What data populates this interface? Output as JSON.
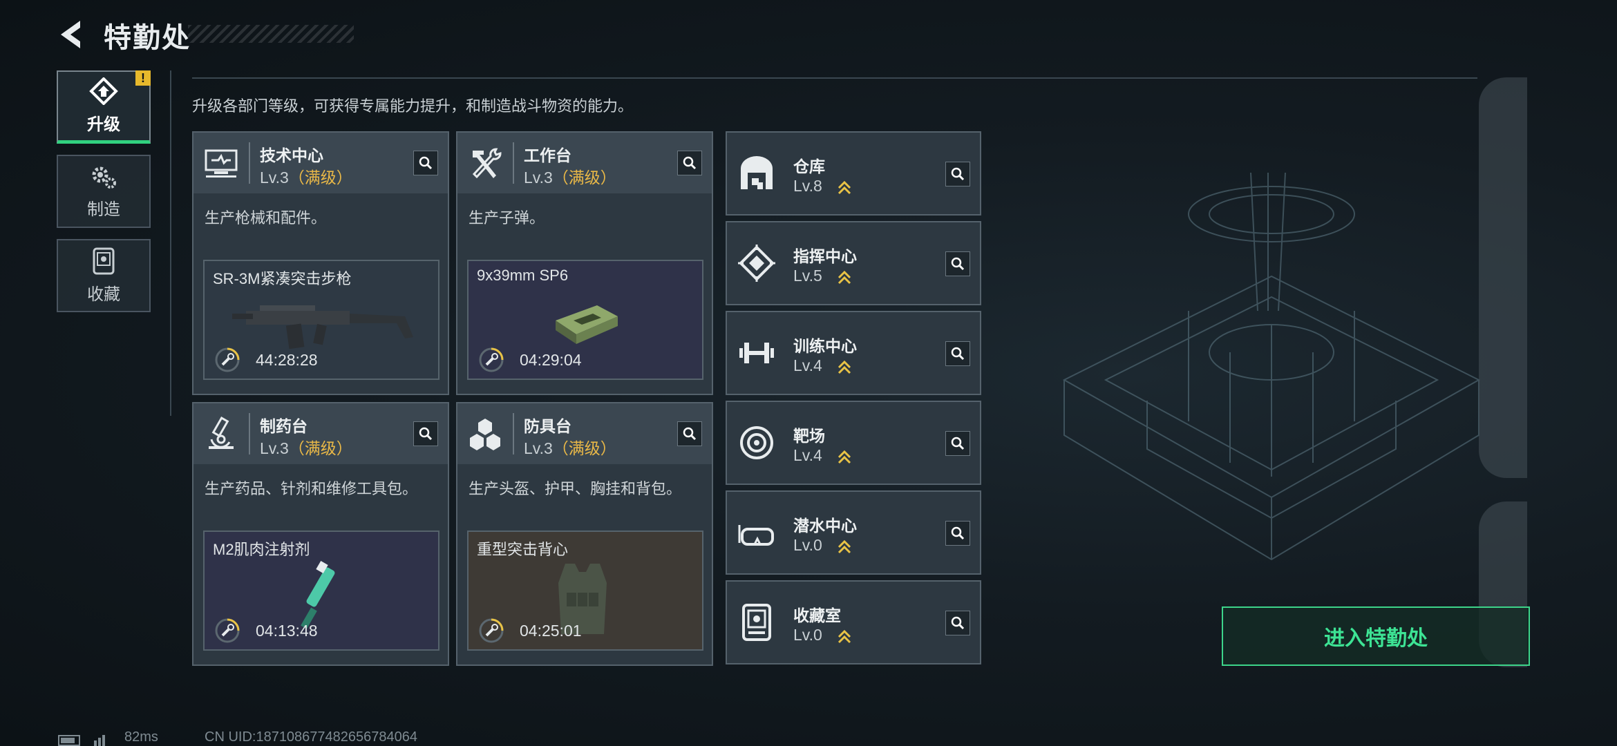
{
  "header": {
    "title": "特勤处"
  },
  "nav": [
    {
      "label": "升级",
      "icon": "upgrade-icon",
      "active": true,
      "badge": "!"
    },
    {
      "label": "制造",
      "icon": "gears-icon",
      "active": false
    },
    {
      "label": "收藏",
      "icon": "collection-icon",
      "active": false
    }
  ],
  "description": "升级各部门等级，可获得专属能力提升，和制造战斗物资的能力。",
  "max_tag": "（满级）",
  "cards": [
    {
      "name": "技术中心",
      "level": "Lv.3",
      "desc": "生产枪械和配件。",
      "product": "SR-3M紧凑突击步枪",
      "time": "44:28:28",
      "icon": "monitor-icon"
    },
    {
      "name": "工作台",
      "level": "Lv.3",
      "desc": "生产子弹。",
      "product": "9x39mm SP6",
      "time": "04:29:04",
      "icon": "tools-icon"
    },
    {
      "name": "制药台",
      "level": "Lv.3",
      "desc": "生产药品、针剂和维修工具包。",
      "product": "M2肌肉注射剂",
      "time": "04:13:48",
      "icon": "microscope-icon"
    },
    {
      "name": "防具台",
      "level": "Lv.3",
      "desc": "生产头盔、护甲、胸挂和背包。",
      "product": "重型突击背心",
      "time": "04:25:01",
      "icon": "cubes-icon"
    }
  ],
  "facilities": [
    {
      "name": "仓库",
      "level": "Lv.8",
      "icon": "warehouse-icon"
    },
    {
      "name": "指挥中心",
      "level": "Lv.5",
      "icon": "chip-icon"
    },
    {
      "name": "训练中心",
      "level": "Lv.4",
      "icon": "dumbbell-icon"
    },
    {
      "name": "靶场",
      "level": "Lv.4",
      "icon": "target-icon"
    },
    {
      "name": "潜水中心",
      "level": "Lv.0",
      "icon": "goggles-icon"
    },
    {
      "name": "收藏室",
      "level": "Lv.0",
      "icon": "display-case-icon"
    }
  ],
  "enter_button": "进入特勤处",
  "footer": {
    "ping": "82ms",
    "uid": "CN UID:1871086774826567840​64"
  },
  "colors": {
    "accent_green": "#3de394",
    "max_gold": "#e9b847",
    "card_bg": "#2d3841"
  }
}
